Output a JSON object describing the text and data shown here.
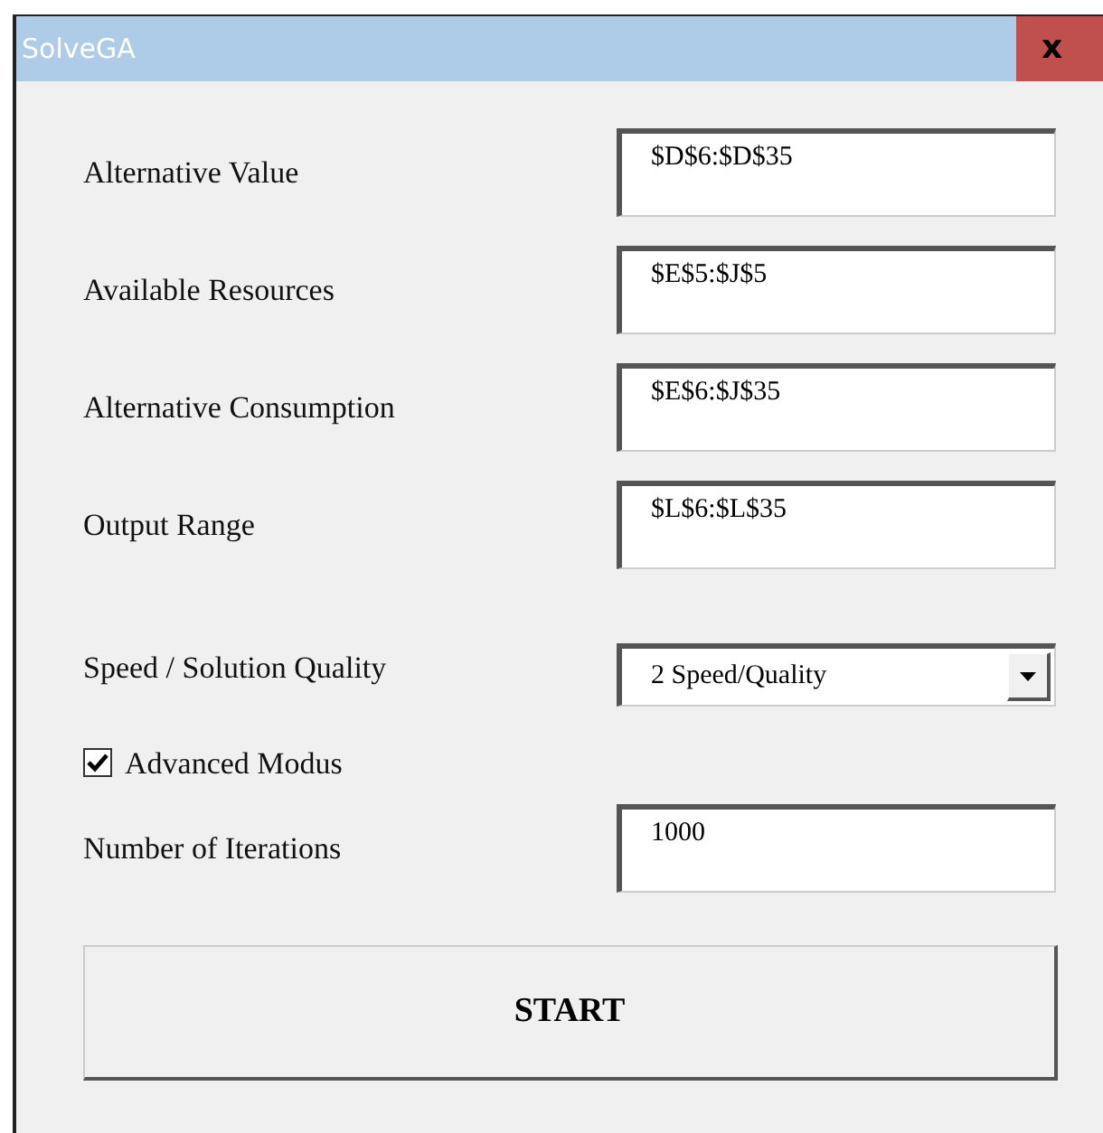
{
  "window": {
    "title": "SolveGA",
    "close": "x"
  },
  "fields": [
    {
      "label": "Alternative Value",
      "value": "$D$6:$D$35"
    },
    {
      "label": "Available Resources",
      "value": "$E$5:$J$5"
    },
    {
      "label": "Alternative Consumption",
      "value": "$E$6:$J$35"
    },
    {
      "label": "Output Range",
      "value": "$L$6:$L$35"
    }
  ],
  "speed": {
    "label": "Speed / Solution Quality",
    "value": "2 Speed/Quality"
  },
  "advanced": {
    "label": "Advanced Modus",
    "checked": true
  },
  "iterations": {
    "label": "Number of Iterations",
    "value": "1000"
  },
  "start_button": "START"
}
